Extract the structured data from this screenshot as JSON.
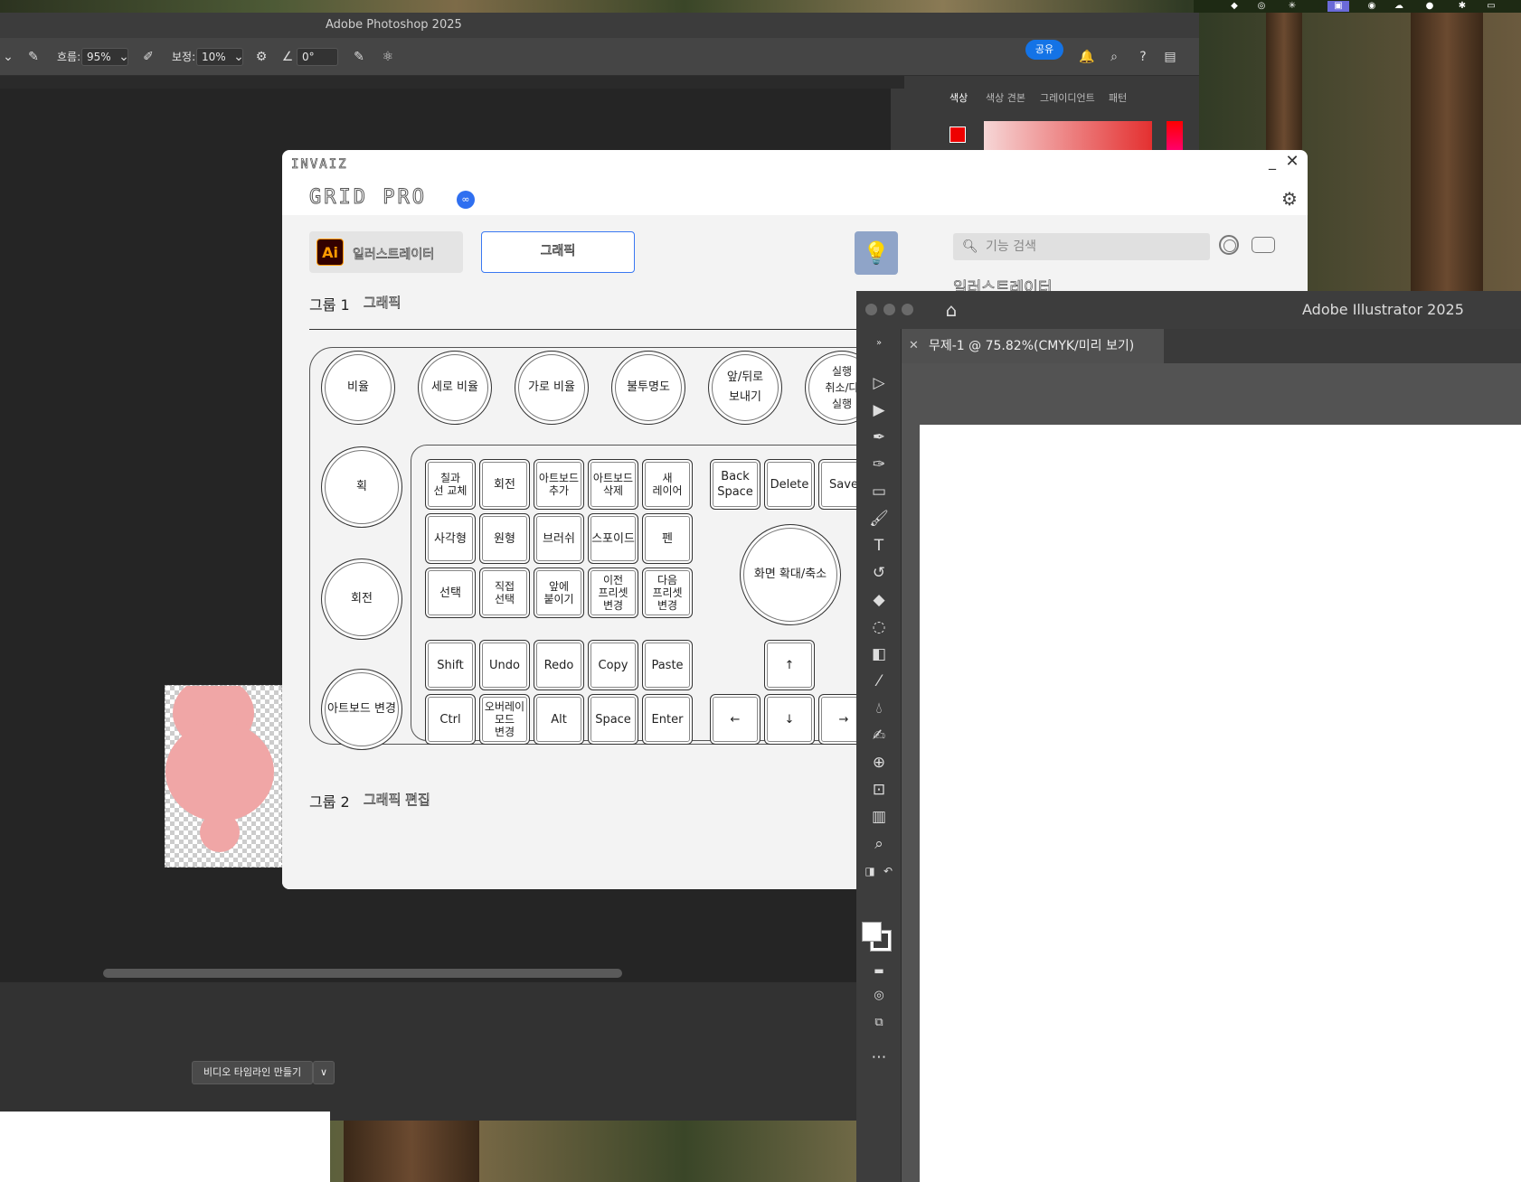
{
  "photoshop": {
    "title": "Adobe Photoshop 2025",
    "options": {
      "flow_label": "흐름:",
      "flow_value": "95%",
      "smoothing_label": "보정:",
      "smoothing_value": "10%",
      "angle_value": "0°"
    },
    "share_label": "공유",
    "panel_tabs": [
      "색상",
      "색상 견본",
      "그레이디언트",
      "패턴"
    ],
    "timeline_button": "비디오 타임라인 만들기"
  },
  "gridpro": {
    "brand": "INVAIZ",
    "logo": "GRID PRO",
    "app_button": "일러스트레이터",
    "group_button": "그래픽",
    "search_placeholder": "기능 검색",
    "app_label": "일러스트레이터",
    "group1_prefix": "그룹 1",
    "group1_name": "그래픽",
    "group2_prefix": "그룹 2",
    "group2_name": "그래픽 편집",
    "top_dials": [
      "비율",
      "세로 비율",
      "가로 비율",
      "불투명도",
      "앞/뒤로\n보내기",
      "실행\n취소/다\n실행"
    ],
    "left_dials": [
      "획",
      "회전",
      "아트보드 변경"
    ],
    "big_dial": "화면 확대/축소",
    "keys_row1": [
      "칠과\n선 교체",
      "회전",
      "아트보드\n추가",
      "아트보드\n삭제",
      "새\n레이어"
    ],
    "keys_row1_right": [
      "Back\nSpace",
      "Delete",
      "Save"
    ],
    "keys_row2": [
      "사각형",
      "원형",
      "브러쉬",
      "스포이드",
      "펜"
    ],
    "keys_row3": [
      "선택",
      "직접\n선택",
      "앞에\n붙이기",
      "이전\n프리셋\n변경",
      "다음\n프리셋\n변경"
    ],
    "keys_row4": [
      "Shift",
      "Undo",
      "Redo",
      "Copy",
      "Paste"
    ],
    "keys_row5": [
      "Ctrl",
      "오버레이\n모드\n변경",
      "Alt",
      "Space",
      "Enter"
    ],
    "arrow_up": "↑",
    "arrows_bottom": [
      "←",
      "↓",
      "→"
    ]
  },
  "illustrator": {
    "title": "Adobe Illustrator 2025",
    "tab_label": "무제-1 @ 75.82%(CMYK/미리 보기)"
  }
}
